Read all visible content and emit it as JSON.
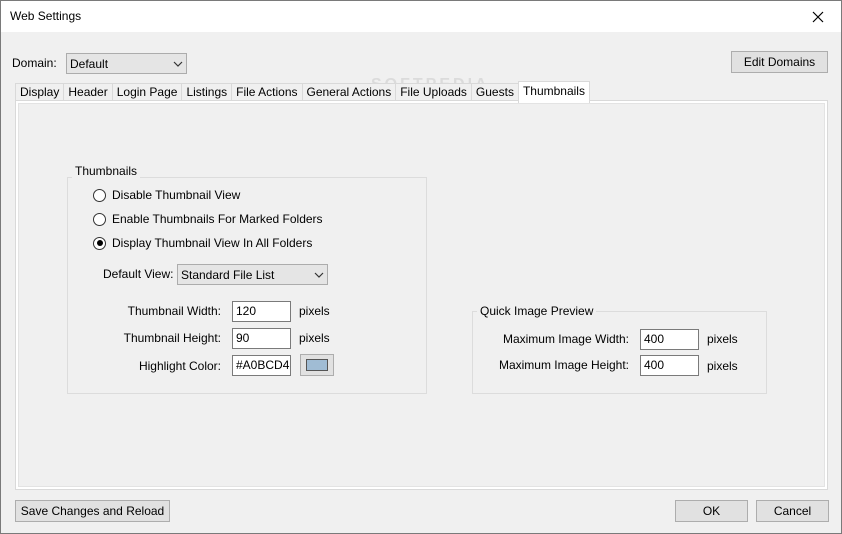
{
  "window": {
    "title": "Web Settings"
  },
  "domain": {
    "label": "Domain:",
    "value": "Default"
  },
  "edit_domains_label": "Edit Domains",
  "tabs": [
    {
      "label": "Display"
    },
    {
      "label": "Header"
    },
    {
      "label": "Login Page"
    },
    {
      "label": "Listings"
    },
    {
      "label": "File Actions"
    },
    {
      "label": "General Actions"
    },
    {
      "label": "File Uploads"
    },
    {
      "label": "Guests"
    },
    {
      "label": "Thumbnails"
    }
  ],
  "active_tab": "Thumbnails",
  "watermark": "SOFTPEDIA",
  "thumbnails": {
    "title": "Thumbnails",
    "options": [
      {
        "label": "Disable Thumbnail View",
        "checked": false
      },
      {
        "label": "Enable Thumbnails For Marked Folders",
        "checked": false
      },
      {
        "label": "Display Thumbnail View In All Folders",
        "checked": true
      }
    ],
    "default_view": {
      "label": "Default View:",
      "value": "Standard File List"
    },
    "width": {
      "label": "Thumbnail Width:",
      "value": "120",
      "unit": "pixels"
    },
    "height": {
      "label": "Thumbnail Height:",
      "value": "90",
      "unit": "pixels"
    },
    "highlight": {
      "label": "Highlight Color:",
      "value": "#A0BCD4",
      "swatch_color": "#A0BCD4"
    }
  },
  "quick_preview": {
    "title": "Quick Image Preview",
    "max_width": {
      "label": "Maximum Image Width:",
      "value": "400",
      "unit": "pixels"
    },
    "max_height": {
      "label": "Maximum Image Height:",
      "value": "400",
      "unit": "pixels"
    }
  },
  "footer": {
    "save_reload_label": "Save Changes and Reload",
    "ok_label": "OK",
    "cancel_label": "Cancel"
  }
}
